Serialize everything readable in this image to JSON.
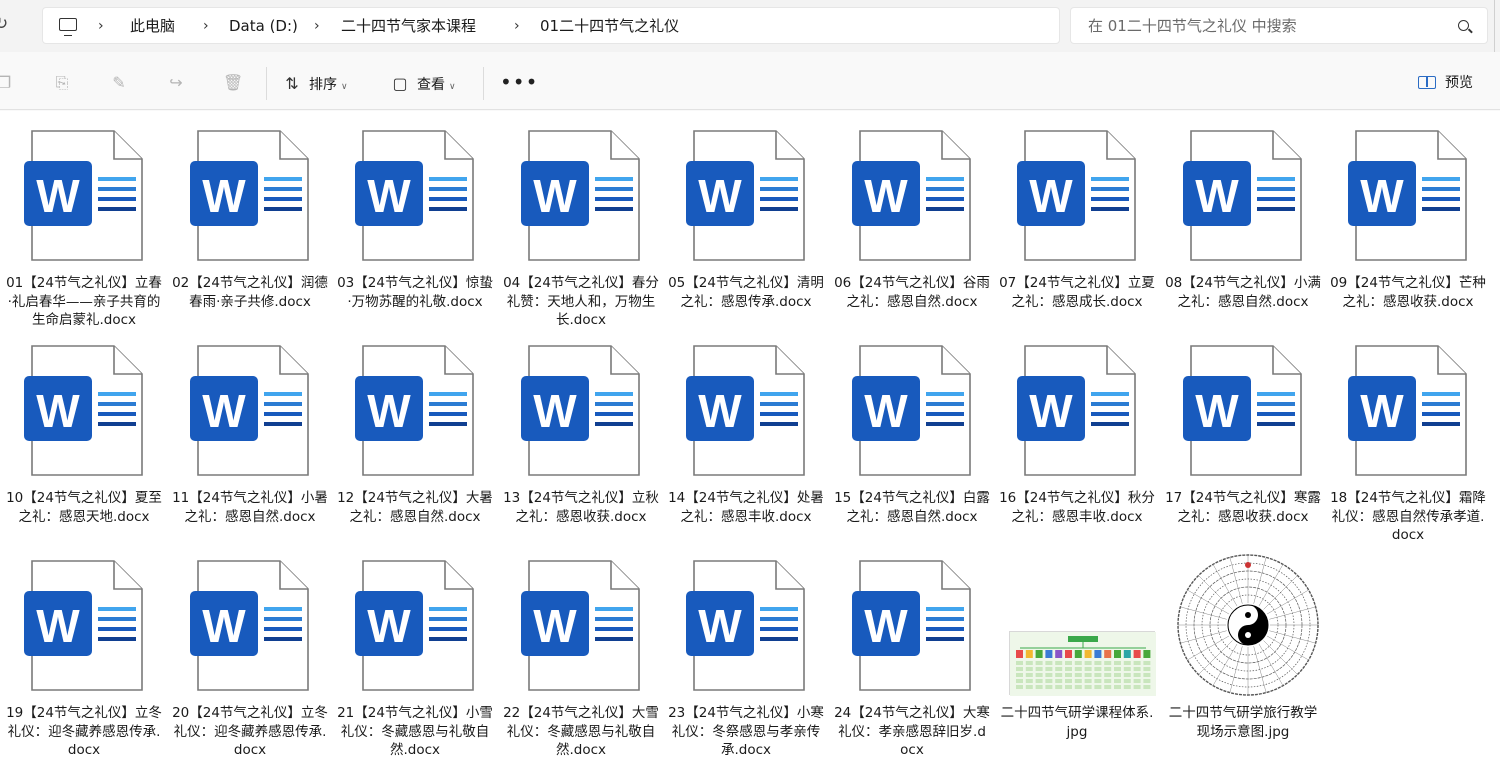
{
  "address_bar": {
    "breadcrumbs": [
      "此电脑",
      "Data (D:)",
      "二十四节气家本课程",
      "01二十四节气之礼仪"
    ]
  },
  "search": {
    "placeholder": "在 01二十四节气之礼仪 中搜索"
  },
  "toolbar": {
    "sort_label": "排序",
    "view_label": "查看",
    "more_label": "•••",
    "preview_label": "预览",
    "disabled_icons": [
      "copy-icon",
      "paste-icon",
      "rename-icon",
      "share-icon",
      "delete-icon"
    ]
  },
  "files": [
    {
      "name": "01【24节气之礼仪】立春·礼启春华——亲子共育的生命启蒙礼.docx",
      "type": "docx"
    },
    {
      "name": "02【24节气之礼仪】润德春雨·亲子共修.docx",
      "type": "docx"
    },
    {
      "name": "03【24节气之礼仪】惊蛰·万物苏醒的礼敬.docx",
      "type": "docx"
    },
    {
      "name": "04【24节气之礼仪】春分礼赞：天地人和，万物生长.docx",
      "type": "docx"
    },
    {
      "name": "05【24节气之礼仪】清明之礼：感恩传承.docx",
      "type": "docx"
    },
    {
      "name": "06【24节气之礼仪】谷雨之礼：感恩自然.docx",
      "type": "docx"
    },
    {
      "name": "07【24节气之礼仪】立夏之礼：感恩成长.docx",
      "type": "docx"
    },
    {
      "name": "08【24节气之礼仪】小满之礼：感恩自然.docx",
      "type": "docx"
    },
    {
      "name": "09【24节气之礼仪】芒种之礼：感恩收获.docx",
      "type": "docx"
    },
    {
      "name": "10【24节气之礼仪】夏至之礼：感恩天地.docx",
      "type": "docx"
    },
    {
      "name": "11【24节气之礼仪】小暑之礼：感恩自然.docx",
      "type": "docx"
    },
    {
      "name": "12【24节气之礼仪】大暑之礼：感恩自然.docx",
      "type": "docx"
    },
    {
      "name": "13【24节气之礼仪】立秋之礼：感恩收获.docx",
      "type": "docx"
    },
    {
      "name": "14【24节气之礼仪】处暑之礼：感恩丰收.docx",
      "type": "docx"
    },
    {
      "name": "15【24节气之礼仪】白露之礼：感恩自然.docx",
      "type": "docx"
    },
    {
      "name": "16【24节气之礼仪】秋分之礼：感恩丰收.docx",
      "type": "docx"
    },
    {
      "name": "17【24节气之礼仪】寒露之礼：感恩收获.docx",
      "type": "docx"
    },
    {
      "name": "18【24节气之礼仪】霜降礼仪：感恩自然传承孝道.docx",
      "type": "docx"
    },
    {
      "name": "19【24节气之礼仪】立冬礼仪：迎冬藏养感恩传承.docx",
      "type": "docx"
    },
    {
      "name": "20【24节气之礼仪】立冬礼仪：迎冬藏养感恩传承.docx",
      "type": "docx"
    },
    {
      "name": "21【24节气之礼仪】小雪礼仪：冬藏感恩与礼敬自然.docx",
      "type": "docx"
    },
    {
      "name": "22【24节气之礼仪】大雪礼仪：冬藏感恩与礼敬自然.docx",
      "type": "docx"
    },
    {
      "name": "23【24节气之礼仪】小寒礼仪：冬祭感恩与孝亲传承.docx",
      "type": "docx"
    },
    {
      "name": "24【24节气之礼仪】大寒礼仪：孝亲感恩辞旧岁.docx",
      "type": "docx"
    },
    {
      "name": "二十四节气研学课程体系.jpg",
      "type": "jpg-diagram"
    },
    {
      "name": "二十四节气研学旅行教学现场示意图.jpg",
      "type": "jpg-compass"
    }
  ],
  "colors": {
    "word_blue": "#185abd",
    "accent": "#2b6cc4",
    "selection": "#cce8ff"
  }
}
